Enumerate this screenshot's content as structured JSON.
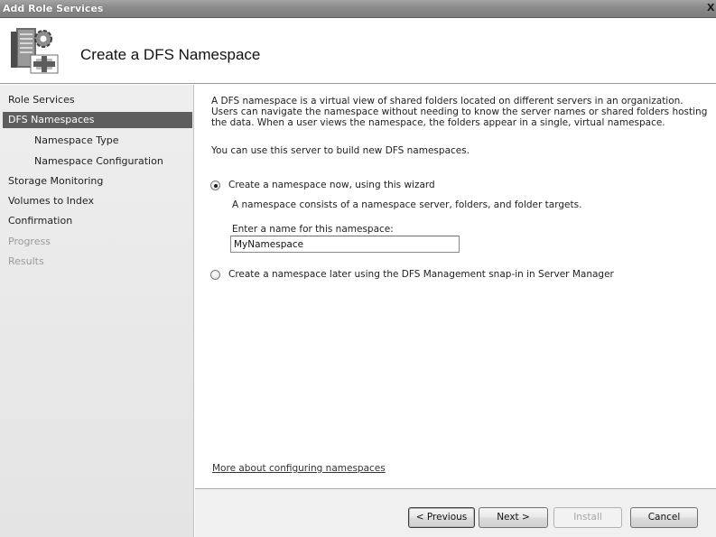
{
  "window": {
    "title": "Add Role Services",
    "close_glyph": "X"
  },
  "header": {
    "heading": "Create a DFS Namespace",
    "icon": "server-wizard-icon"
  },
  "sidebar": {
    "items": [
      {
        "label": "Role Services",
        "state": "normal"
      },
      {
        "label": "DFS Namespaces",
        "state": "active"
      },
      {
        "label": "Namespace Type",
        "state": "normal"
      },
      {
        "label": "Namespace Configuration",
        "state": "normal"
      },
      {
        "label": "Storage Monitoring",
        "state": "normal"
      },
      {
        "label": "Volumes to Index",
        "state": "normal"
      },
      {
        "label": "Confirmation",
        "state": "normal"
      },
      {
        "label": "Progress",
        "state": "disabled"
      },
      {
        "label": "Results",
        "state": "disabled"
      }
    ]
  },
  "main": {
    "description": "A DFS namespace is a virtual view of shared folders located on different servers in an organization. Users can navigate the namespace without needing to know the server names or shared folders hosting the data. When a user views the namespace, the folders appear in a single, virtual namespace.",
    "build_text": "You can use this server to build new DFS namespaces.",
    "option_now": {
      "label": "Create a namespace now, using this wizard",
      "checked": true,
      "detail": "A namespace consists of a namespace server, folders, and folder targets.",
      "name_label": "Enter a name for this namespace:",
      "name_value": "MyNamespace"
    },
    "option_later": {
      "label": "Create a namespace later using the DFS Management snap-in in Server Manager",
      "checked": false
    },
    "more_link": "More about configuring namespaces"
  },
  "footer": {
    "previous": "< Previous",
    "next": "Next >",
    "install": "Install",
    "cancel": "Cancel"
  },
  "colors": {
    "active_nav": "#5e5e5e",
    "titlebar": "#8a8a8a",
    "sidebar_bg": "#e8e8e8"
  }
}
